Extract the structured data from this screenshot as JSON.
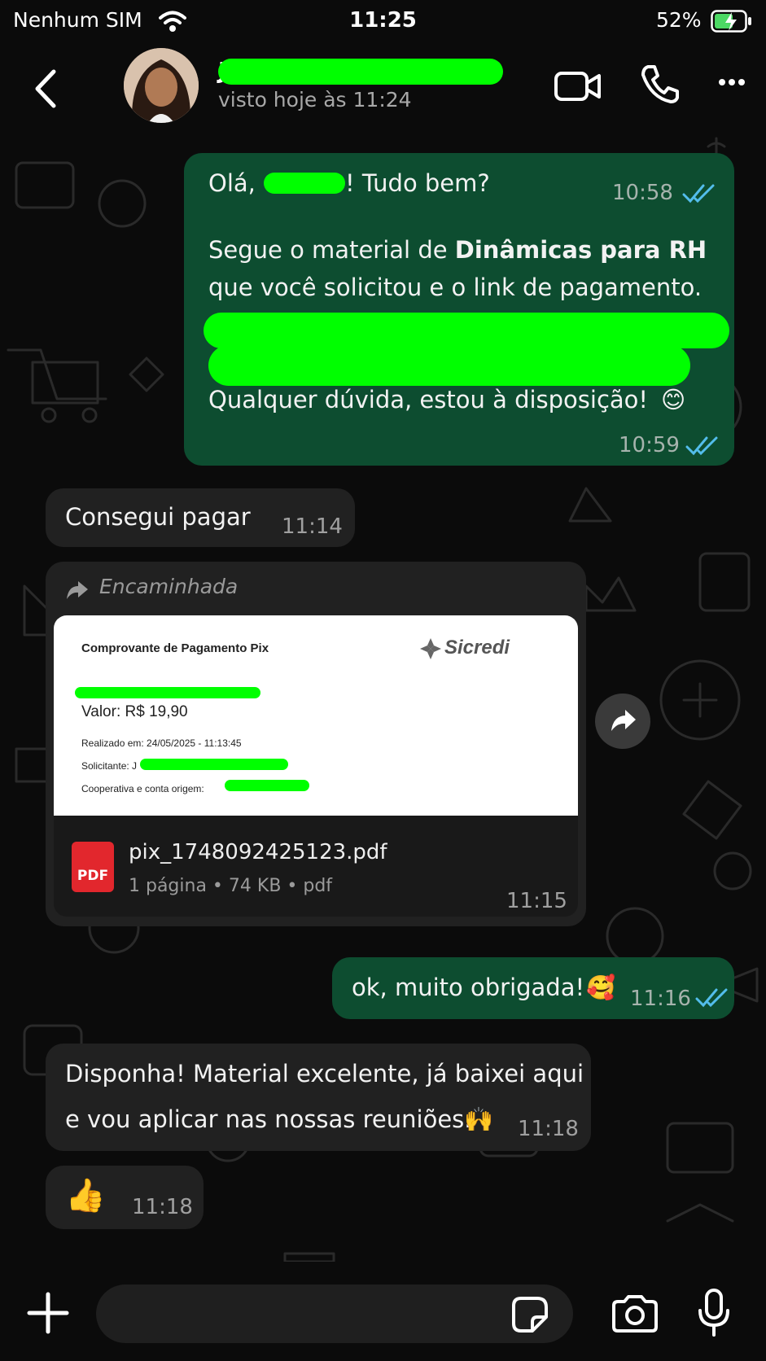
{
  "status_bar": {
    "carrier": "Nenhum SIM",
    "time": "11:25",
    "battery": "52%"
  },
  "header": {
    "contact_initial": "J",
    "last_seen": "visto hoje às 11:24",
    "icons": [
      "back-chevron-icon",
      "video-call-icon",
      "phone-icon",
      "more-icon"
    ]
  },
  "messages": {
    "m1": {
      "greeting_prefix": "Olá,",
      "greeting_suffix": "! Tudo bem?",
      "time_1": "10:58",
      "line2_prefix": "Segue o material de ",
      "line2_bold": "Dinâmicas para RH",
      "line3": "que você solicitou e o link de pagamento.",
      "line4": "Qualquer dúvida, estou à disposição!",
      "emoji": "😊",
      "time_2": "10:59"
    },
    "m2": {
      "text": "Consegui pagar",
      "time": "11:14"
    },
    "m3": {
      "forwarded_label": "Encaminhada",
      "doc_title": "Comprovante de Pagamento Pix",
      "doc_brand": "Sicredi",
      "doc_value": "Valor: R$ 19,90",
      "doc_realizado": "Realizado em: 24/05/2025 - 11:13:45",
      "doc_solicitante": "Solicitante: J",
      "doc_cooperativa": "Cooperativa e conta origem:",
      "file_icon_label": "PDF",
      "file_name": "pix_1748092425123.pdf",
      "file_meta": "1 página • 74 KB • pdf",
      "time": "11:15"
    },
    "m4": {
      "text": "ok, muito obrigada!",
      "emoji": "🥰",
      "time": "11:16"
    },
    "m5": {
      "line1": "Disponha! Material excelente, já baixei aqui",
      "line2": "e vou aplicar nas nossas reuniões.",
      "emoji": "🙌",
      "time": "11:18"
    },
    "m6": {
      "emoji": "👍",
      "time": "11:18"
    }
  },
  "composer": {
    "icons": [
      "plus-icon",
      "sticker-icon",
      "camera-icon",
      "microphone-icon"
    ]
  },
  "colors": {
    "outgoing_bubble": "#0d4d30",
    "incoming_bubble": "#212121",
    "read_ticks": "#53bdeb",
    "redaction": "#00ff00"
  }
}
